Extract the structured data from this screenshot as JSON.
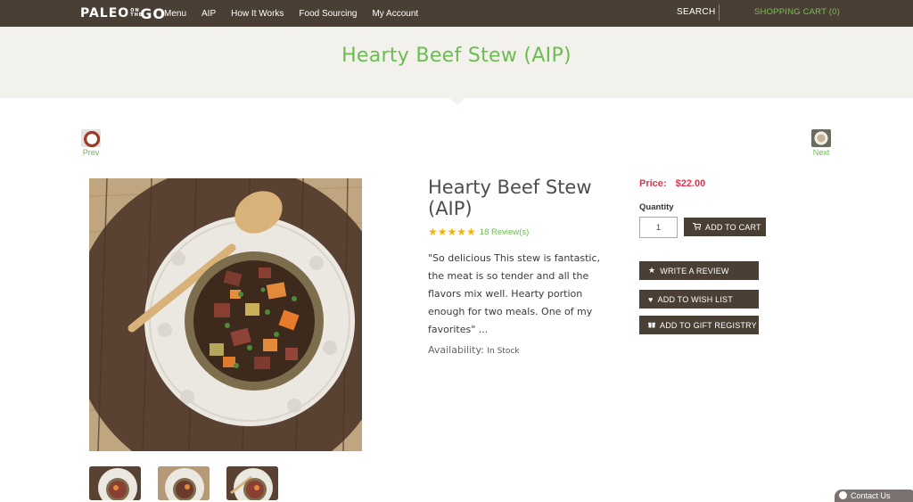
{
  "brand": {
    "logo_left": "PALEO",
    "logo_small": "ON THE",
    "logo_right": "GO"
  },
  "nav": {
    "items": [
      {
        "label": "Menu"
      },
      {
        "label": "AIP"
      },
      {
        "label": "How It Works"
      },
      {
        "label": "Food Sourcing"
      },
      {
        "label": "My Account"
      }
    ],
    "search_label": "SEARCH",
    "cart_label": "SHOPPING CART (0)"
  },
  "hero": {
    "title": "Hearty Beef Stew (AIP)"
  },
  "pager": {
    "prev_label": "Prev",
    "next_label": "Next"
  },
  "product": {
    "title": "Hearty Beef Stew (AIP)",
    "stars": "★★★★★",
    "rating": 5,
    "review_count_label": "18 Review(s)",
    "description": "\"So delicious This stew is fantastic, the meat is so tender and all the flavors mix well. Hearty portion enough for two meals. One of my favorites\" ...",
    "availability_label": "Availability:",
    "availability_value": "In Stock",
    "price_label": "Price:",
    "price_value": "$22.00",
    "quantity_label": "Quantity",
    "quantity_value": "1"
  },
  "actions": {
    "add_to_cart": "ADD TO CART",
    "write_review": "WRITE A REVIEW",
    "wish_list": "ADD TO WISH LIST",
    "gift_registry": "ADD TO GIFT REGISTRY"
  },
  "contact": {
    "label": "Contact Us"
  },
  "colors": {
    "nav_bg": "#4a3f35",
    "accent_green": "#6bbd4f",
    "price_red": "#d6384f",
    "star_gold": "#f5b300",
    "hero_bg": "#f3f1ec"
  },
  "icons": {
    "cart": "cart-icon",
    "star": "star-icon",
    "heart": "heart-icon",
    "gift": "gift-icon"
  }
}
